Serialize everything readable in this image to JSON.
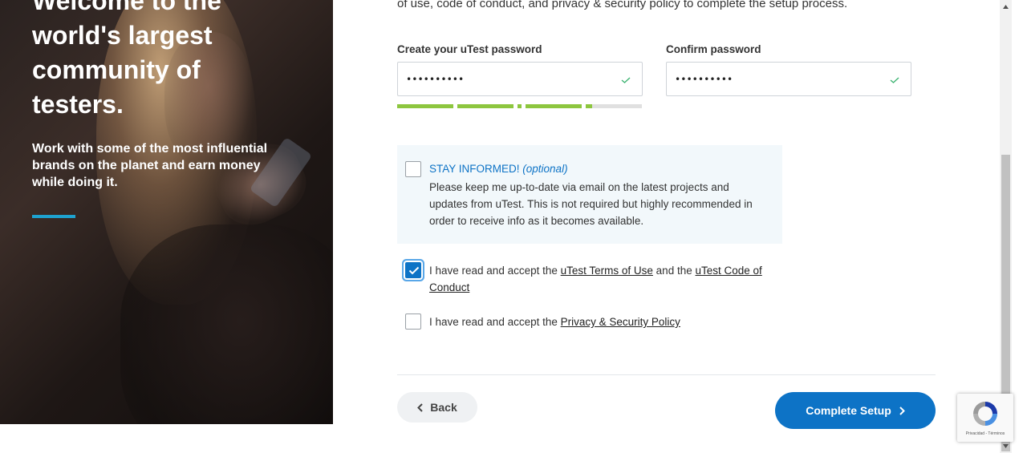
{
  "hero": {
    "title": "Welcome to the\nworld's largest\ncommunity of\ntesters.",
    "subtitle": "Work with some of the most influential\nbrands on the planet and earn money\nwhile doing it.",
    "accent_color": "#1ea2cf"
  },
  "intro": {
    "text": "of use, code of conduct, and privacy & security policy to complete the setup process."
  },
  "password": {
    "label": "Create your uTest password",
    "value": "••••••••••",
    "valid_icon": "check-icon",
    "strength": 0.78
  },
  "confirm": {
    "label": "Confirm password",
    "value": "••••••••••",
    "valid_icon": "check-icon"
  },
  "stay_informed": {
    "title": "STAY INFORMED!",
    "optional": "(optional)",
    "description": "Please keep me up-to-date via email on the latest projects and updates from uTest. This is not required but highly recommended in order to receive info as it becomes available.",
    "checked": false
  },
  "terms": {
    "prefix": "I have read and accept the ",
    "link1": "uTest Terms of Use",
    "middle": " and the ",
    "link2": "uTest Code of Conduct",
    "checked": true
  },
  "privacy": {
    "prefix": "I have read and accept the ",
    "link": "Privacy & Security Policy",
    "checked": false
  },
  "buttons": {
    "back": "Back",
    "complete": "Complete Setup"
  },
  "recaptcha": {
    "legal": "Privacidad - Términos"
  },
  "colors": {
    "primary": "#0d73c6",
    "strength_green": "#8dc63f",
    "valid_check": "#3cb371"
  }
}
